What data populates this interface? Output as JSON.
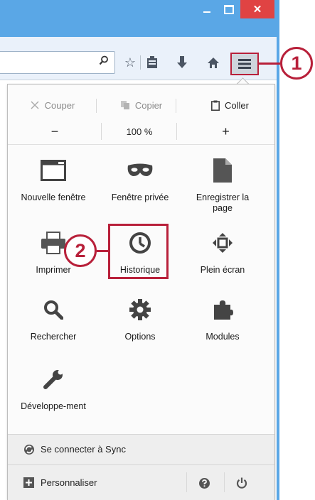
{
  "window": {
    "close_glyph": "✕"
  },
  "edit": {
    "cut": "Couper",
    "copy": "Copier",
    "paste": "Coller"
  },
  "zoom": {
    "minus": "−",
    "level": "100 %",
    "plus": "+"
  },
  "items": {
    "new_window": "Nouvelle fenêtre",
    "private_window": "Fenêtre privée",
    "save_page": "Enregistrer la page",
    "print": "Imprimer",
    "history": "Historique",
    "fullscreen": "Plein écran",
    "find": "Rechercher",
    "options": "Options",
    "addons": "Modules",
    "developer": "Développe-ment"
  },
  "footer": {
    "sync": "Se connecter à Sync",
    "customize": "Personnaliser"
  },
  "callouts": {
    "one": "1",
    "two": "2"
  },
  "colors": {
    "titlebar": "#5aa7e6",
    "callout": "#b8203a",
    "close": "#e04343"
  }
}
